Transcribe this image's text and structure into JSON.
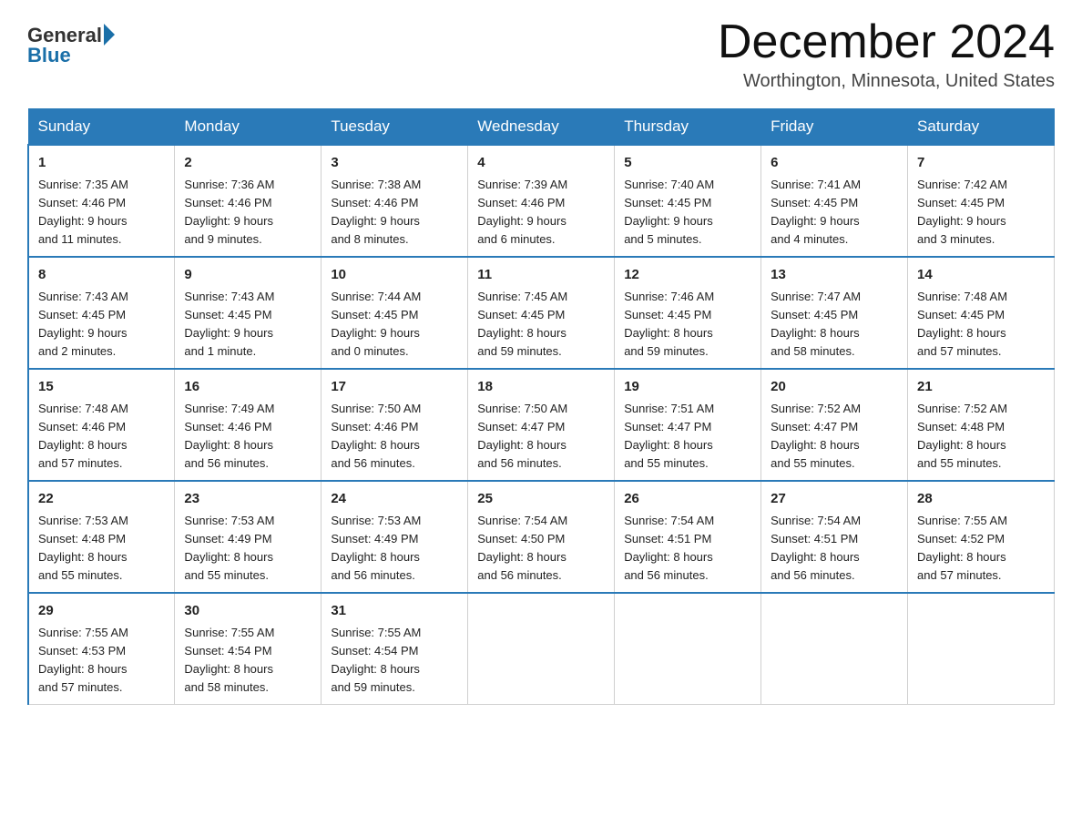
{
  "logo": {
    "general": "General",
    "blue": "Blue"
  },
  "title": {
    "month_year": "December 2024",
    "location": "Worthington, Minnesota, United States"
  },
  "headers": [
    "Sunday",
    "Monday",
    "Tuesday",
    "Wednesday",
    "Thursday",
    "Friday",
    "Saturday"
  ],
  "weeks": [
    [
      {
        "day": "1",
        "sunrise": "7:35 AM",
        "sunset": "4:46 PM",
        "daylight": "9 hours and 11 minutes."
      },
      {
        "day": "2",
        "sunrise": "7:36 AM",
        "sunset": "4:46 PM",
        "daylight": "9 hours and 9 minutes."
      },
      {
        "day": "3",
        "sunrise": "7:38 AM",
        "sunset": "4:46 PM",
        "daylight": "9 hours and 8 minutes."
      },
      {
        "day": "4",
        "sunrise": "7:39 AM",
        "sunset": "4:46 PM",
        "daylight": "9 hours and 6 minutes."
      },
      {
        "day": "5",
        "sunrise": "7:40 AM",
        "sunset": "4:45 PM",
        "daylight": "9 hours and 5 minutes."
      },
      {
        "day": "6",
        "sunrise": "7:41 AM",
        "sunset": "4:45 PM",
        "daylight": "9 hours and 4 minutes."
      },
      {
        "day": "7",
        "sunrise": "7:42 AM",
        "sunset": "4:45 PM",
        "daylight": "9 hours and 3 minutes."
      }
    ],
    [
      {
        "day": "8",
        "sunrise": "7:43 AM",
        "sunset": "4:45 PM",
        "daylight": "9 hours and 2 minutes."
      },
      {
        "day": "9",
        "sunrise": "7:43 AM",
        "sunset": "4:45 PM",
        "daylight": "9 hours and 1 minute."
      },
      {
        "day": "10",
        "sunrise": "7:44 AM",
        "sunset": "4:45 PM",
        "daylight": "9 hours and 0 minutes."
      },
      {
        "day": "11",
        "sunrise": "7:45 AM",
        "sunset": "4:45 PM",
        "daylight": "8 hours and 59 minutes."
      },
      {
        "day": "12",
        "sunrise": "7:46 AM",
        "sunset": "4:45 PM",
        "daylight": "8 hours and 59 minutes."
      },
      {
        "day": "13",
        "sunrise": "7:47 AM",
        "sunset": "4:45 PM",
        "daylight": "8 hours and 58 minutes."
      },
      {
        "day": "14",
        "sunrise": "7:48 AM",
        "sunset": "4:45 PM",
        "daylight": "8 hours and 57 minutes."
      }
    ],
    [
      {
        "day": "15",
        "sunrise": "7:48 AM",
        "sunset": "4:46 PM",
        "daylight": "8 hours and 57 minutes."
      },
      {
        "day": "16",
        "sunrise": "7:49 AM",
        "sunset": "4:46 PM",
        "daylight": "8 hours and 56 minutes."
      },
      {
        "day": "17",
        "sunrise": "7:50 AM",
        "sunset": "4:46 PM",
        "daylight": "8 hours and 56 minutes."
      },
      {
        "day": "18",
        "sunrise": "7:50 AM",
        "sunset": "4:47 PM",
        "daylight": "8 hours and 56 minutes."
      },
      {
        "day": "19",
        "sunrise": "7:51 AM",
        "sunset": "4:47 PM",
        "daylight": "8 hours and 55 minutes."
      },
      {
        "day": "20",
        "sunrise": "7:52 AM",
        "sunset": "4:47 PM",
        "daylight": "8 hours and 55 minutes."
      },
      {
        "day": "21",
        "sunrise": "7:52 AM",
        "sunset": "4:48 PM",
        "daylight": "8 hours and 55 minutes."
      }
    ],
    [
      {
        "day": "22",
        "sunrise": "7:53 AM",
        "sunset": "4:48 PM",
        "daylight": "8 hours and 55 minutes."
      },
      {
        "day": "23",
        "sunrise": "7:53 AM",
        "sunset": "4:49 PM",
        "daylight": "8 hours and 55 minutes."
      },
      {
        "day": "24",
        "sunrise": "7:53 AM",
        "sunset": "4:49 PM",
        "daylight": "8 hours and 56 minutes."
      },
      {
        "day": "25",
        "sunrise": "7:54 AM",
        "sunset": "4:50 PM",
        "daylight": "8 hours and 56 minutes."
      },
      {
        "day": "26",
        "sunrise": "7:54 AM",
        "sunset": "4:51 PM",
        "daylight": "8 hours and 56 minutes."
      },
      {
        "day": "27",
        "sunrise": "7:54 AM",
        "sunset": "4:51 PM",
        "daylight": "8 hours and 56 minutes."
      },
      {
        "day": "28",
        "sunrise": "7:55 AM",
        "sunset": "4:52 PM",
        "daylight": "8 hours and 57 minutes."
      }
    ],
    [
      {
        "day": "29",
        "sunrise": "7:55 AM",
        "sunset": "4:53 PM",
        "daylight": "8 hours and 57 minutes."
      },
      {
        "day": "30",
        "sunrise": "7:55 AM",
        "sunset": "4:54 PM",
        "daylight": "8 hours and 58 minutes."
      },
      {
        "day": "31",
        "sunrise": "7:55 AM",
        "sunset": "4:54 PM",
        "daylight": "8 hours and 59 minutes."
      },
      null,
      null,
      null,
      null
    ]
  ],
  "labels": {
    "sunrise": "Sunrise:",
    "sunset": "Sunset:",
    "daylight": "Daylight:"
  }
}
